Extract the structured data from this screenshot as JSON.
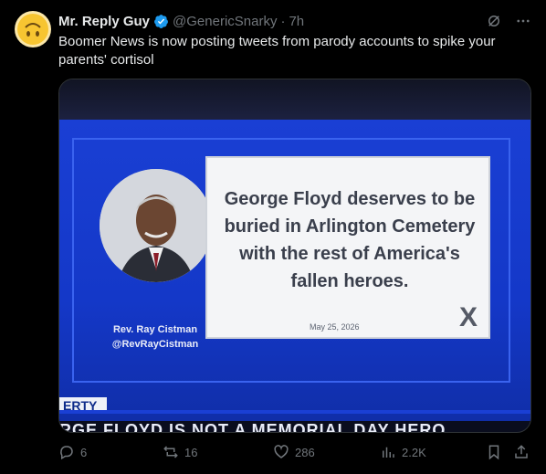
{
  "tweet": {
    "name": "Mr. Reply Guy",
    "handle": "@GenericSnarky",
    "separator": "·",
    "time": "7h",
    "text": "Boomer News is now posting tweets from parody accounts to spike your parents' cortisol",
    "verified_color": "#1d9bf0"
  },
  "media": {
    "person_name": "Rev. Ray Cistman",
    "person_handle": "@RevRayCistman",
    "quote": "George Floyd deserves to be buried in Arlington Cemetery with the rest of America's fallen heroes.",
    "quote_date": "May 25, 2026",
    "x_logo": "X",
    "chyron_top": "ERTY",
    "chyron_bottom": "RGE FLOYD IS NOT A MEMORIAL DAY HERO"
  },
  "actions": {
    "replies": "6",
    "reposts": "16",
    "likes": "286",
    "views": "2.2K"
  },
  "colors": {
    "background": "#000000",
    "muted": "#71767b",
    "tv_blue": "#1438c8"
  }
}
